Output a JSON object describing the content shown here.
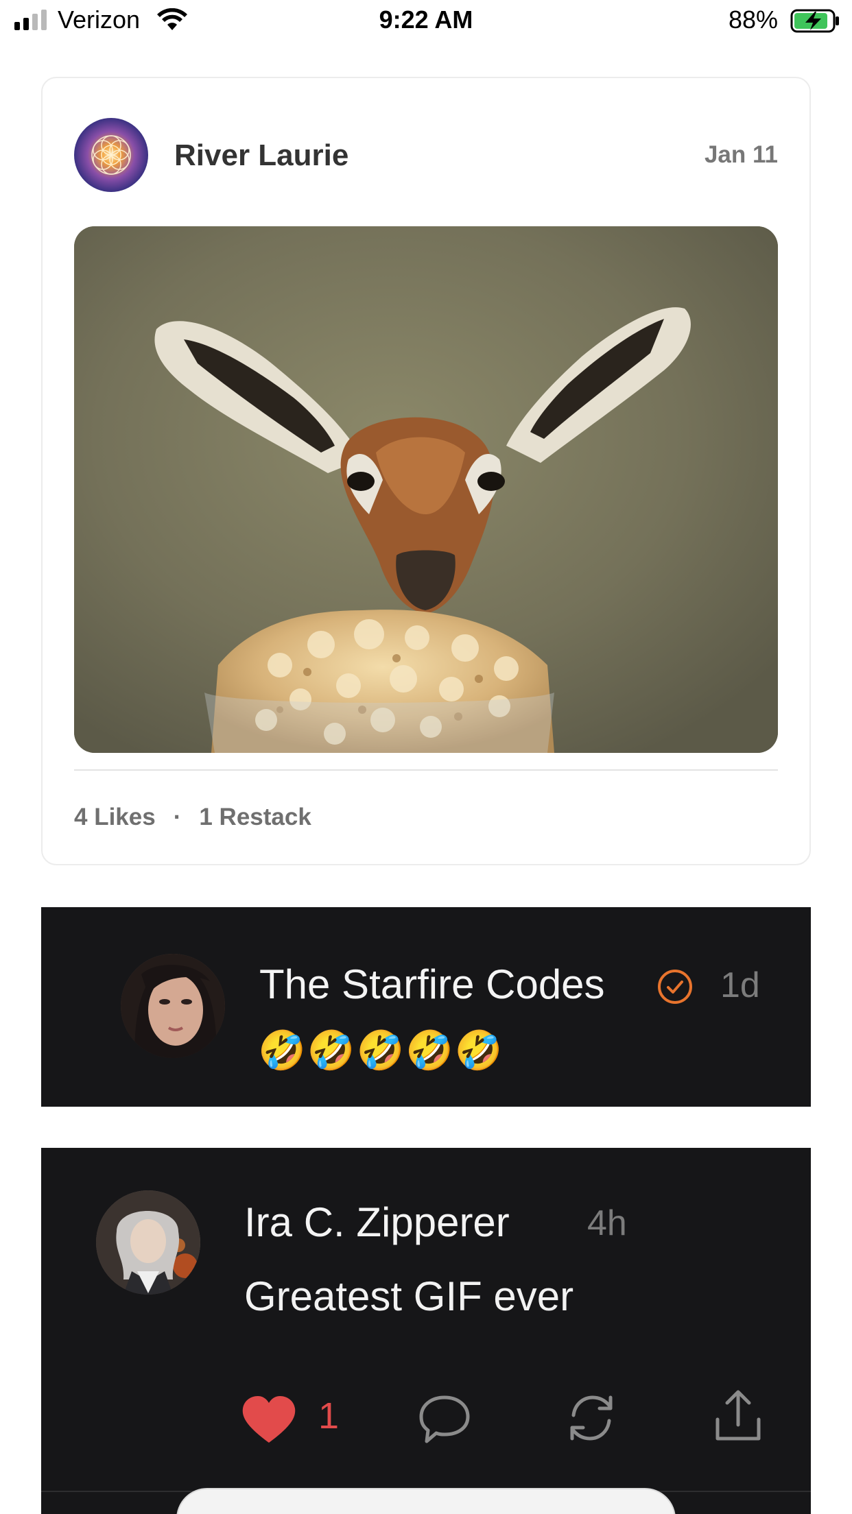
{
  "status_bar": {
    "carrier": "Verizon",
    "time": "9:22 AM",
    "battery": "88%"
  },
  "post": {
    "author": "River Laurie",
    "date": "Jan 11",
    "likes": "4 Likes",
    "separator": "·",
    "restacks": "1 Restack"
  },
  "comments": [
    {
      "name": "The Starfire Codes",
      "time": "1d",
      "body": "🤣🤣🤣🤣🤣",
      "verified_color": "#e8742d"
    },
    {
      "name": "Ira C. Zipperer",
      "time": "4h",
      "body": "Greatest GIF ever",
      "like_count": "1",
      "like_color": "#e24b4b"
    }
  ]
}
